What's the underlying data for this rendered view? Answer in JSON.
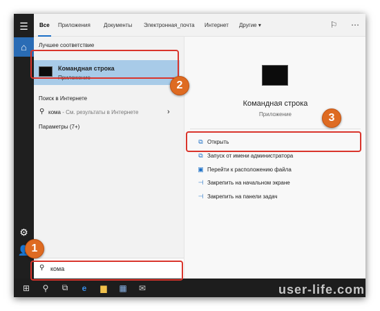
{
  "tabs": [
    {
      "label": "Все"
    },
    {
      "label": "Приложения"
    },
    {
      "label": "Документы"
    },
    {
      "label": "Электронная_почта"
    },
    {
      "label": "Интернет"
    },
    {
      "label": "Другие ▾"
    }
  ],
  "left": {
    "best_header": "Лучшее соответствие",
    "best_title": "Командная строка",
    "best_subtitle": "Приложение",
    "web_header": "Поиск в Интернете",
    "web_query": "кома",
    "web_hint": " - См. результаты в Интернете",
    "params": "Параметры (7+)"
  },
  "right": {
    "app_title": "Командная строка",
    "app_subtitle": "Приложение",
    "actions": [
      {
        "label": "Открыть",
        "icon": "open-icon"
      },
      {
        "label": "Запуск от имени администратора",
        "icon": "admin-icon"
      },
      {
        "label": "Перейти к расположению файла",
        "icon": "file-location-icon"
      },
      {
        "label": "Закрепить на начальном экране",
        "icon": "pin-icon"
      },
      {
        "label": "Закрепить на панели задач",
        "icon": "pin-icon"
      }
    ]
  },
  "search": {
    "value": "кома"
  },
  "badges": {
    "one": "1",
    "two": "2",
    "three": "3"
  },
  "watermark": "user-life.com"
}
